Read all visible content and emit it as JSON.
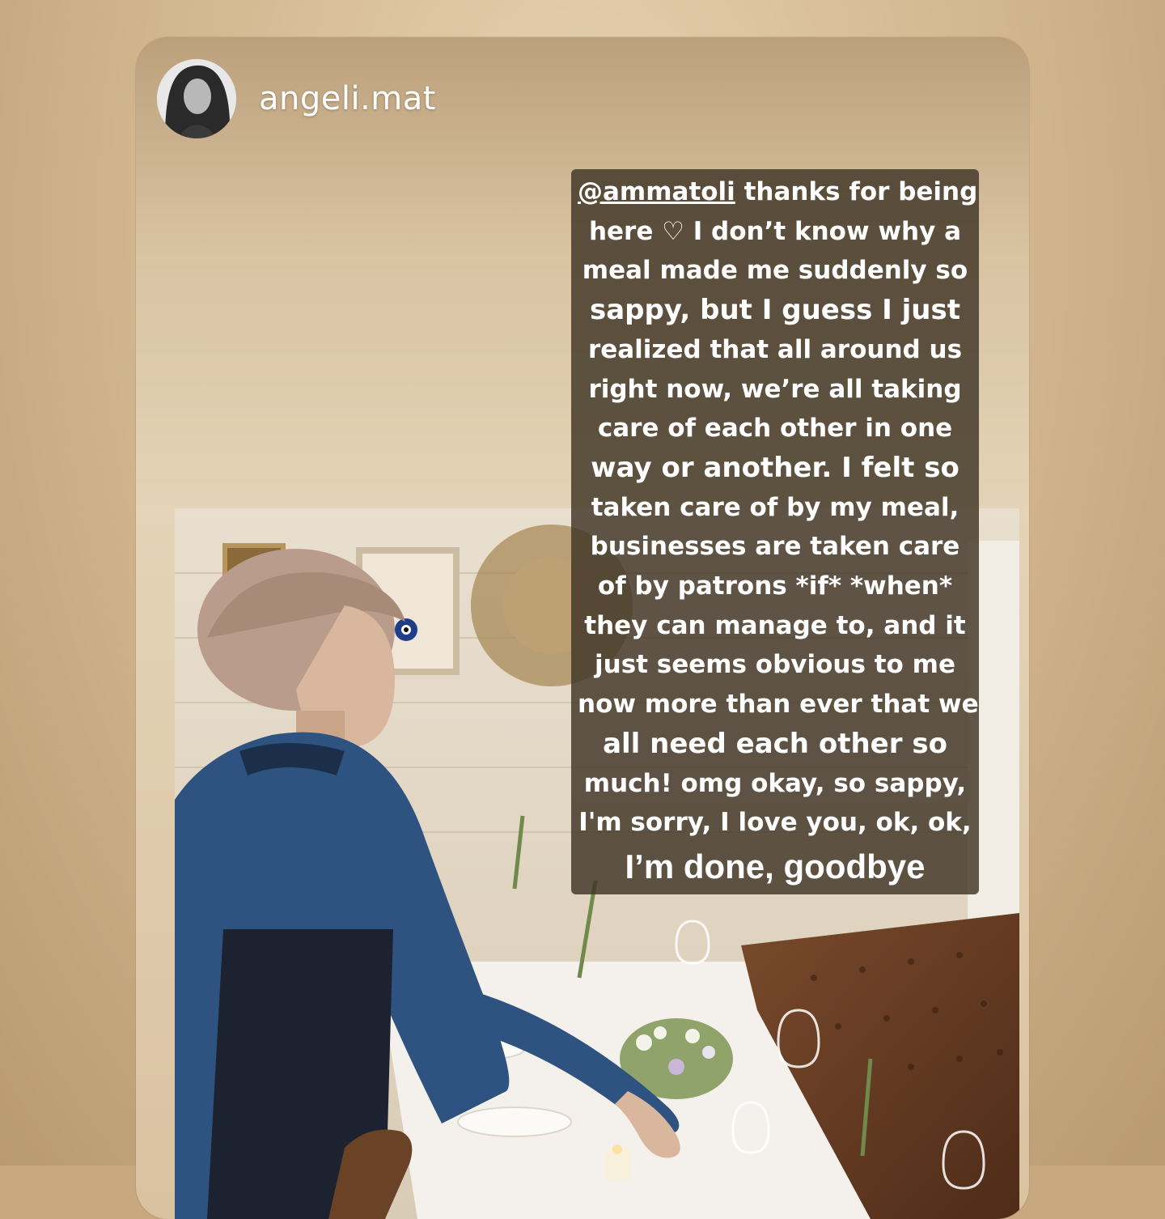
{
  "story": {
    "username": "angeli.mat",
    "mention": "@ammatoli",
    "caption_lines": [
      " thanks for being",
      "here ♡ I don’t know why a",
      "meal made me suddenly so",
      "sappy, but I guess I just",
      "realized that all around us",
      "right now, we’re all taking",
      "care of each other in one",
      "way or another. I felt so",
      "taken care of by my meal,",
      "businesses are taken care",
      "of by patrons *if* *when*",
      "they can manage to, and it",
      "just seems obvious to me",
      "now more than ever that we",
      "all need each other so",
      "much! omg okay, so sappy,",
      "I'm sorry, I love you, ok, ok,",
      "I’m done, goodbye"
    ]
  },
  "colors": {
    "background": "#c7a87f",
    "caption_box": "#403426",
    "caption_text": "#ffffff"
  }
}
